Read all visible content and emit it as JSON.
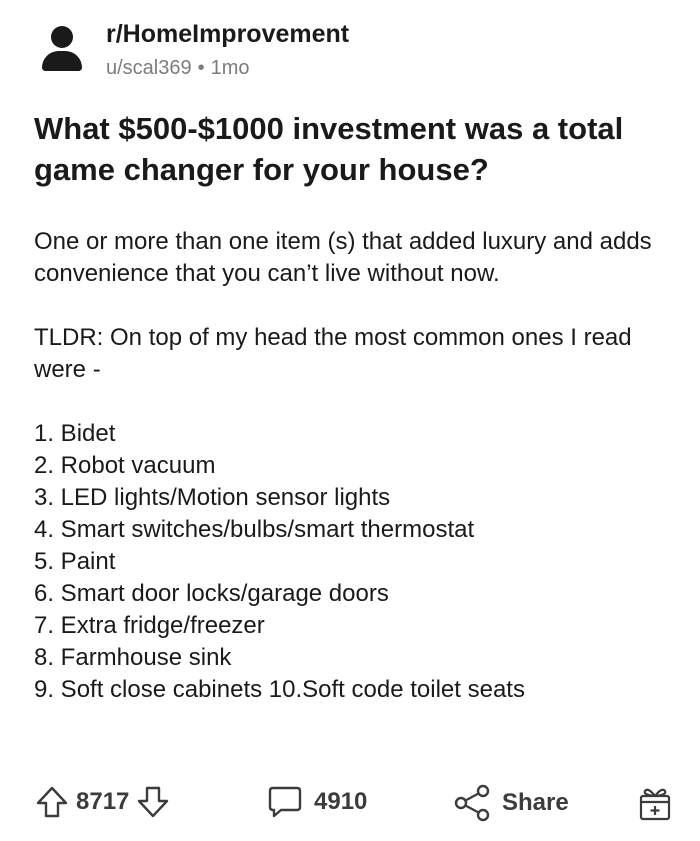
{
  "post": {
    "subreddit": "r/HomeImprovement",
    "author": "u/scal369",
    "separator": "•",
    "age": "1mo",
    "title": "What $500-$1000 investment was a total game changer for your house?",
    "body_paragraph_1": "One or more than one item (s) that added luxury and adds convenience that you can’t live without now.",
    "body_paragraph_2": "TLDR: On top of my head the most common ones I read were -",
    "list_items": [
      "1. Bidet",
      "2. Robot vacuum",
      "3. LED lights/Motion sensor lights",
      "4. Smart switches/bulbs/smart thermostat",
      "5. Paint",
      "6. Smart door locks/garage doors",
      "7. Extra fridge/freezer",
      "8. Farmhouse sink",
      "9. Soft close cabinets 10.Soft code toilet seats"
    ]
  },
  "footer": {
    "vote_count": "8717",
    "comment_count": "4910",
    "share_label": "Share"
  },
  "icons": {
    "avatar": "user-avatar-icon",
    "upvote": "upvote-arrow-icon",
    "downvote": "downvote-arrow-icon",
    "comments": "comment-bubble-icon",
    "share": "share-icon",
    "award": "gift-award-icon"
  },
  "colors": {
    "text": "#1a1a1b",
    "meta": "#7c7c7c",
    "icons": "#3c3c3c",
    "background": "#ffffff"
  }
}
